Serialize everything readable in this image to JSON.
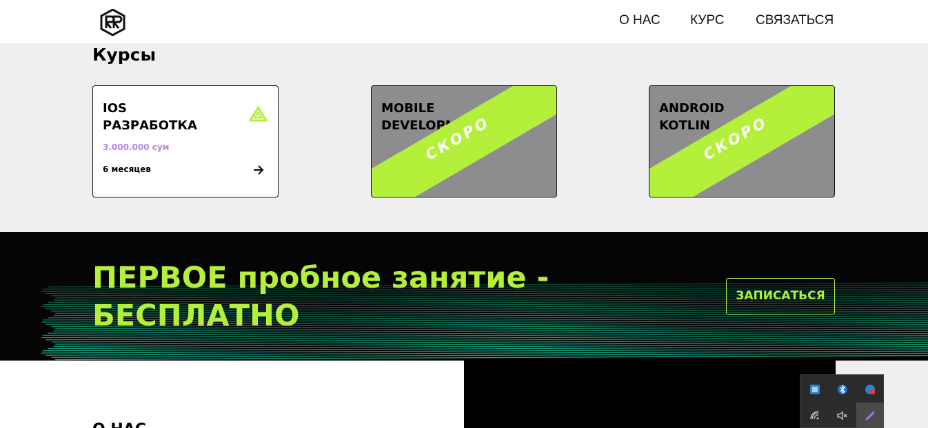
{
  "nav": {
    "about": "О НАС",
    "course": "КУРС",
    "contact": "СВЯЗАТЬСЯ"
  },
  "courses": {
    "title": "Курсы",
    "items": [
      {
        "title": "IOS\nРАЗРАБОТКА",
        "price": "3.000.000 сум",
        "duration": "6 месяцев",
        "icon": "triangle-logo-icon"
      },
      {
        "title": "MOBILE\nDEVELOPMENT",
        "badge": "СКОРО"
      },
      {
        "title": "ANDROID\nKOTLIN",
        "badge": "СКОРО"
      }
    ]
  },
  "promo": {
    "title_line1": "ПЕРВОЕ пробное занятие -",
    "title_line2": "БЕСПЛАТНО",
    "button": "ЗАПИСАТЬСЯ"
  },
  "about": {
    "title": "О НАС"
  },
  "tray": {
    "icons": [
      "app-icon",
      "bluetooth-icon",
      "notification-icon",
      "wifi-icon",
      "muted-speaker-icon",
      "pen-icon"
    ]
  },
  "colors": {
    "accent": "#b4ef3c",
    "price": "#b684e6",
    "card_gray": "#8d8d90",
    "teal_lines": "#1fb48f"
  }
}
